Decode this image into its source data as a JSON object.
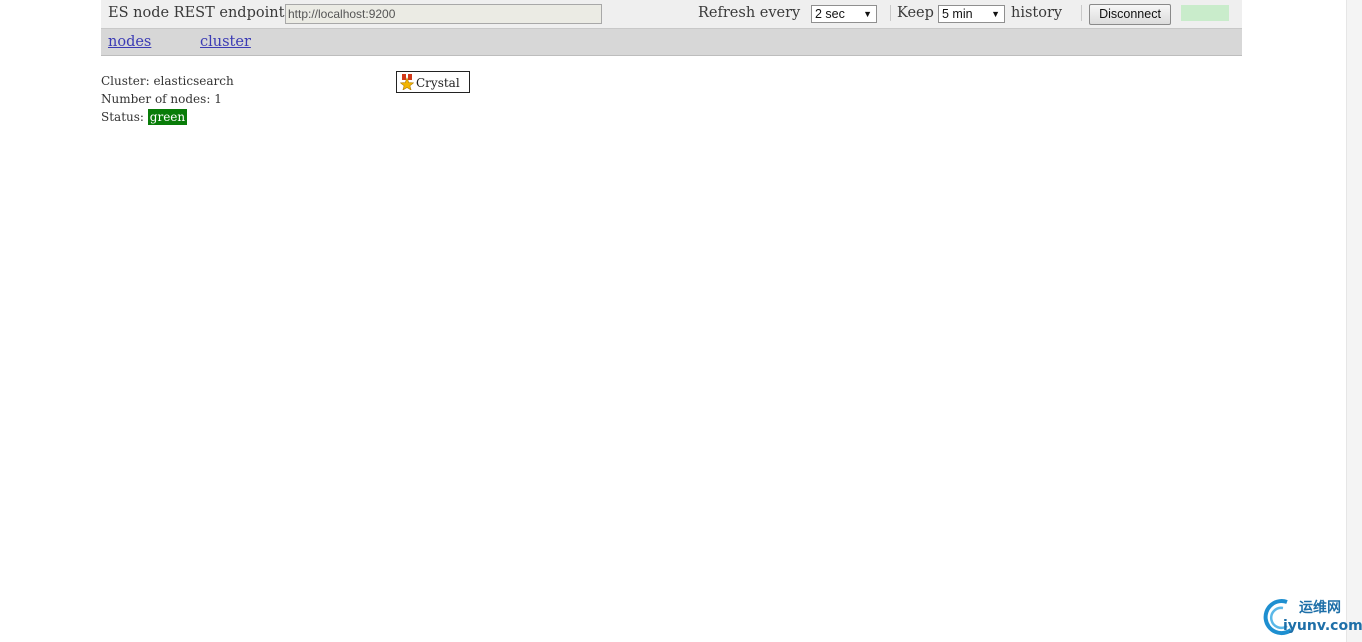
{
  "toolbar": {
    "endpoint_label": "ES node REST endpoint",
    "endpoint_value": "http://localhost:9200",
    "refresh_label": "Refresh every",
    "refresh_value": "2 sec",
    "keep_label": "Keep",
    "keep_value": "5 min",
    "history_label": "history",
    "disconnect_label": "Disconnect",
    "status_color": "#c9eccb"
  },
  "nav": {
    "items": [
      {
        "label": "nodes"
      },
      {
        "label": "cluster"
      }
    ]
  },
  "cluster": {
    "name_label": "Cluster:",
    "name": "elasticsearch",
    "nodes_label": "Number of nodes:",
    "nodes": "1",
    "status_label": "Status:",
    "status": "green",
    "status_color": "#087c08"
  },
  "node": {
    "name": "Crystal",
    "icon": "master-star-icon"
  },
  "watermark": {
    "line1": "运维网",
    "line2": "iyunv.com"
  }
}
